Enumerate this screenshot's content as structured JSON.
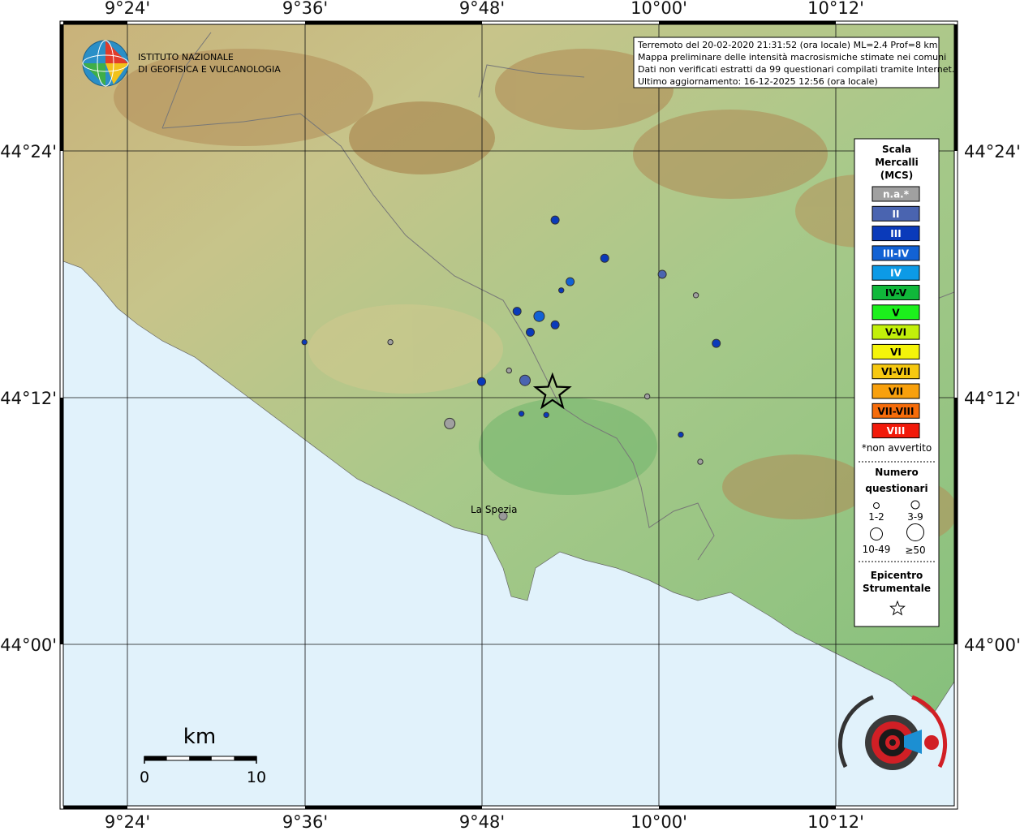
{
  "axes": {
    "lon_labels": [
      "9°24'",
      "9°36'",
      "9°48'",
      "10°00'",
      "10°12'"
    ],
    "lat_labels": [
      "44°24'",
      "44°12'",
      "44°00'"
    ]
  },
  "logo": {
    "line1": "ISTITUTO NAZIONALE",
    "line2": "DI GEOFISICA E VULCANOLOGIA"
  },
  "info": {
    "line1": "Terremoto del 20-02-2020 21:31:52 (ora locale) ML=2.4 Prof=8 km",
    "line2": "Mappa preliminare delle intensità macrosismiche stimate nei comuni",
    "line3": "Dati non verificati estratti da 99 questionari compilati tramite Internet.",
    "line4": "Ultimo aggiornamento: 16-12-2025 12:56 (ora locale)"
  },
  "city": {
    "name": "La Spezia"
  },
  "legend": {
    "title1": "Scala",
    "title2": "Mercalli",
    "title3": "(MCS)",
    "scale": [
      {
        "label": "n.a.*",
        "color": "#a0a0a0",
        "text": "#ffffff"
      },
      {
        "label": "II",
        "color": "#4a64b0",
        "text": "#ffffff"
      },
      {
        "label": "III",
        "color": "#0a3aba",
        "text": "#ffffff"
      },
      {
        "label": "III-IV",
        "color": "#1262d4",
        "text": "#ffffff"
      },
      {
        "label": "IV",
        "color": "#0c9ae6",
        "text": "#ffffff"
      },
      {
        "label": "IV-V",
        "color": "#10b83a",
        "text": "#000000"
      },
      {
        "label": "V",
        "color": "#1cf01c",
        "text": "#000000"
      },
      {
        "label": "V-VI",
        "color": "#c2f00a",
        "text": "#000000"
      },
      {
        "label": "VI",
        "color": "#f4f40a",
        "text": "#000000"
      },
      {
        "label": "VI-VII",
        "color": "#f6c810",
        "text": "#000000"
      },
      {
        "label": "VII",
        "color": "#f8a00c",
        "text": "#000000"
      },
      {
        "label": "VII-VIII",
        "color": "#f66c0a",
        "text": "#000000"
      },
      {
        "label": "VIII",
        "color": "#f21a0a",
        "text": "#ffffff"
      }
    ],
    "note": "*non avvertito",
    "count_title1": "Numero",
    "count_title2": "questionari",
    "count_1": "1-2",
    "count_2": "3-9",
    "count_3": "10-49",
    "count_4": "≥50",
    "epi_title1": "Epicentro",
    "epi_title2": "Strumentale"
  },
  "scalebar": {
    "unit": "km",
    "start": "0",
    "end": "10"
  },
  "points": [
    {
      "lon": 9.697,
      "lat": 44.245,
      "intensity": "n.a.*",
      "count": "1-2"
    },
    {
      "lon": 9.6,
      "lat": 44.245,
      "intensity": "III",
      "count": "1-2"
    },
    {
      "lon": 9.883,
      "lat": 44.344,
      "intensity": "III",
      "count": "3-9"
    },
    {
      "lon": 9.939,
      "lat": 44.313,
      "intensity": "III",
      "count": "3-9"
    },
    {
      "lon": 9.89,
      "lat": 44.287,
      "intensity": "III",
      "count": "1-2"
    },
    {
      "lon": 9.865,
      "lat": 44.266,
      "intensity": "III-IV",
      "count": "10-49"
    },
    {
      "lon": 10.042,
      "lat": 44.283,
      "intensity": "n.a.*",
      "count": "1-2"
    },
    {
      "lon": 10.065,
      "lat": 44.244,
      "intensity": "III",
      "count": "3-9"
    },
    {
      "lon": 9.9,
      "lat": 44.294,
      "intensity": "III-IV",
      "count": "3-9"
    },
    {
      "lon": 10.004,
      "lat": 44.3,
      "intensity": "II",
      "count": "3-9"
    },
    {
      "lon": 9.883,
      "lat": 44.259,
      "intensity": "III",
      "count": "3-9"
    },
    {
      "lon": 9.855,
      "lat": 44.253,
      "intensity": "III",
      "count": "3-9"
    },
    {
      "lon": 9.84,
      "lat": 44.27,
      "intensity": "III",
      "count": "3-9"
    },
    {
      "lon": 9.8,
      "lat": 44.213,
      "intensity": "III",
      "count": "3-9"
    },
    {
      "lon": 9.849,
      "lat": 44.214,
      "intensity": "II",
      "count": "10-49"
    },
    {
      "lon": 9.831,
      "lat": 44.222,
      "intensity": "n.a.*",
      "count": "1-2"
    },
    {
      "lon": 9.845,
      "lat": 44.187,
      "intensity": "III",
      "count": "1-2"
    },
    {
      "lon": 9.873,
      "lat": 44.186,
      "intensity": "III",
      "count": "1-2"
    },
    {
      "lon": 9.764,
      "lat": 44.179,
      "intensity": "n.a.*",
      "count": "10-49"
    },
    {
      "lon": 9.987,
      "lat": 44.201,
      "intensity": "n.a.*",
      "count": "1-2"
    },
    {
      "lon": 10.025,
      "lat": 44.17,
      "intensity": "III",
      "count": "1-2"
    },
    {
      "lon": 10.047,
      "lat": 44.148,
      "intensity": "n.a.*",
      "count": "1-2"
    }
  ],
  "epicenter": {
    "lon": 9.88,
    "lat": 44.204
  }
}
